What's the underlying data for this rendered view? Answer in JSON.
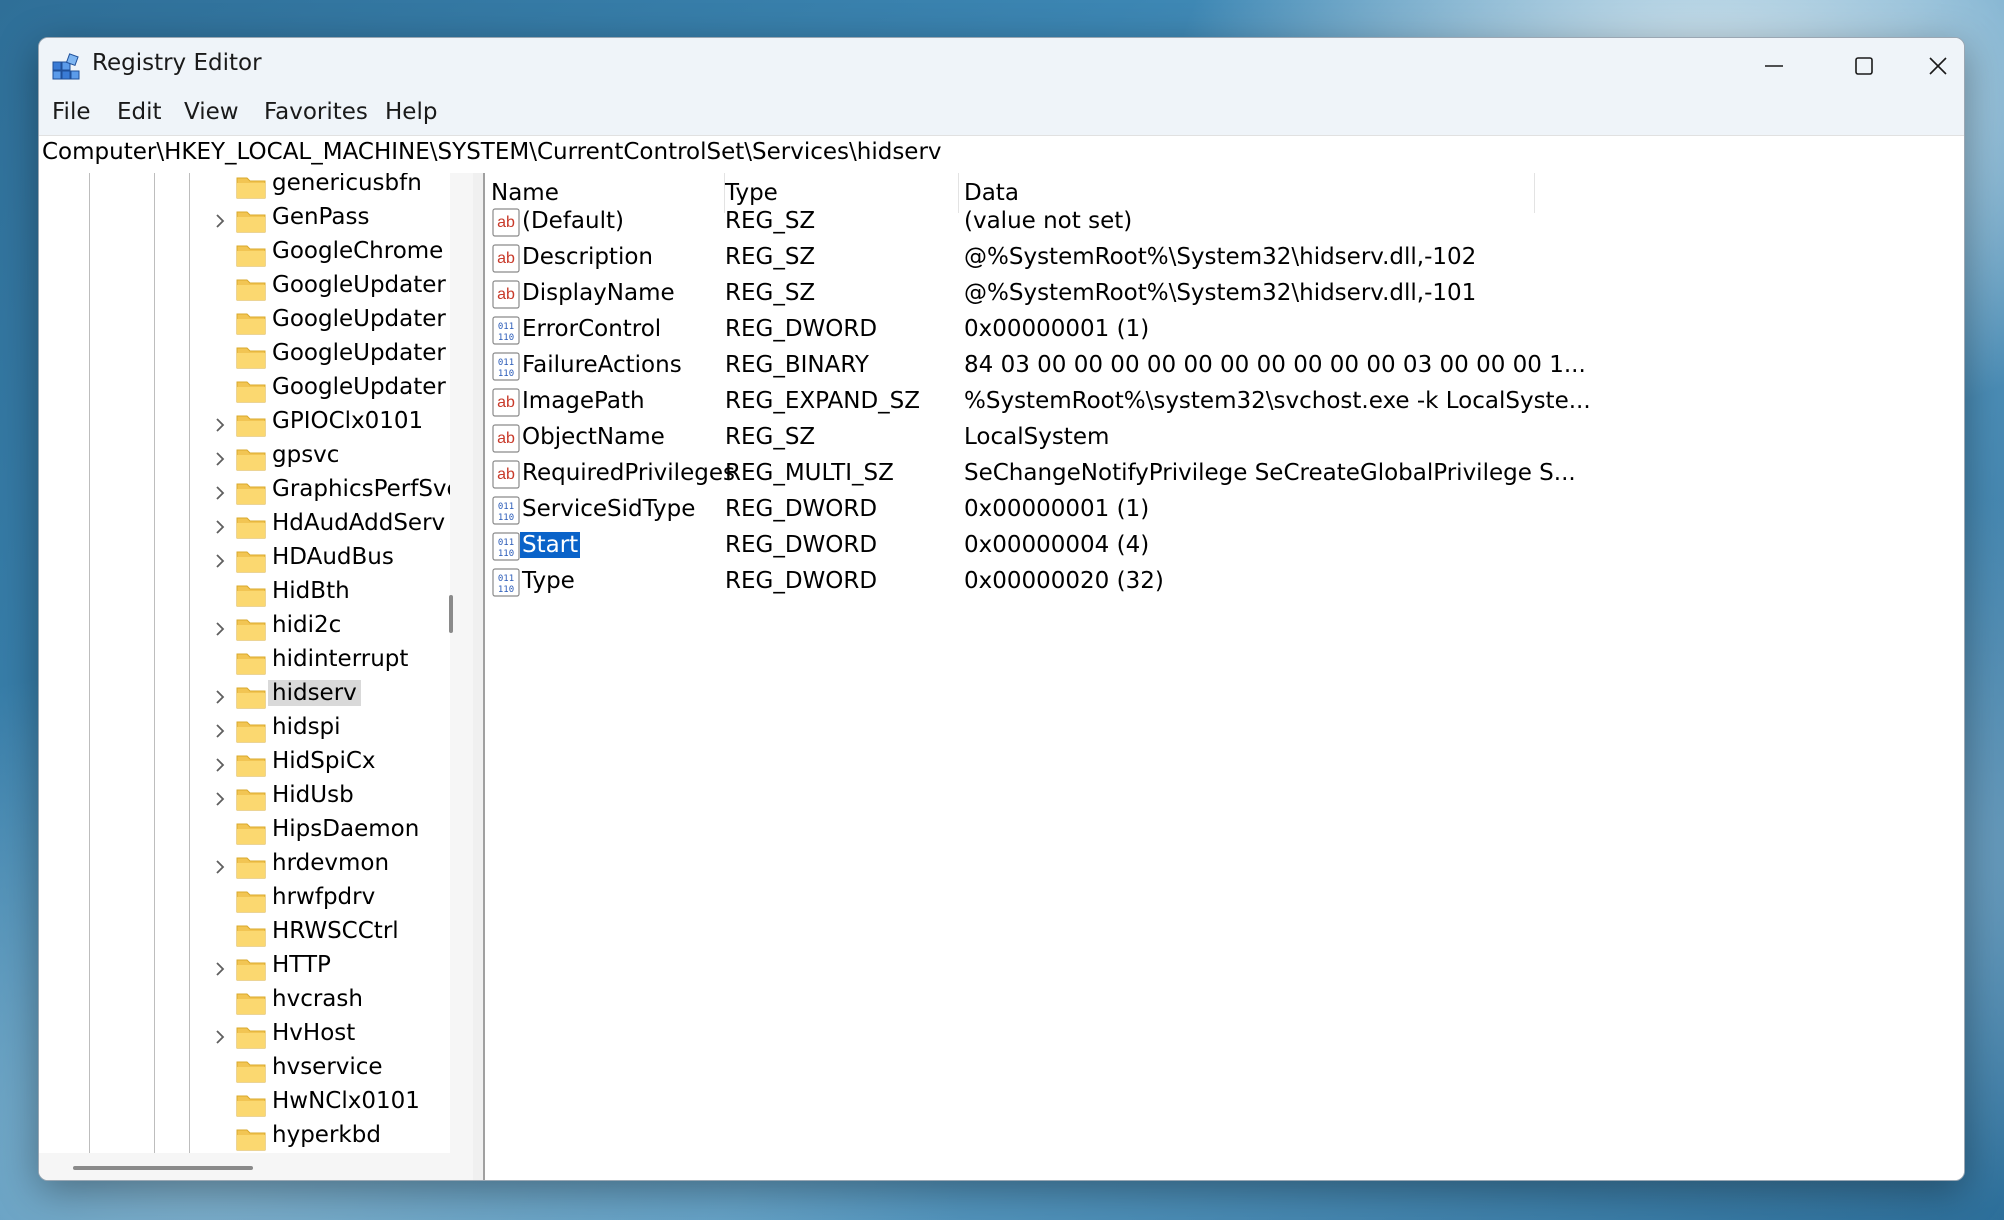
{
  "window": {
    "title": "Registry Editor"
  },
  "menu": [
    "File",
    "Edit",
    "View",
    "Favorites",
    "Help"
  ],
  "address": "Computer\\HKEY_LOCAL_MACHINE\\SYSTEM\\CurrentControlSet\\Services\\hidserv",
  "tree": [
    {
      "label": "genericusbfn",
      "expandable": false
    },
    {
      "label": "GenPass",
      "expandable": true
    },
    {
      "label": "GoogleChrome",
      "expandable": false
    },
    {
      "label": "GoogleUpdater",
      "expandable": false
    },
    {
      "label": "GoogleUpdater",
      "expandable": false
    },
    {
      "label": "GoogleUpdater",
      "expandable": false
    },
    {
      "label": "GoogleUpdater",
      "expandable": false
    },
    {
      "label": "GPIOClx0101",
      "expandable": true
    },
    {
      "label": "gpsvc",
      "expandable": true
    },
    {
      "label": "GraphicsPerfSvc",
      "expandable": true
    },
    {
      "label": "HdAudAddServ",
      "expandable": true
    },
    {
      "label": "HDAudBus",
      "expandable": true
    },
    {
      "label": "HidBth",
      "expandable": false
    },
    {
      "label": "hidi2c",
      "expandable": true
    },
    {
      "label": "hidinterrupt",
      "expandable": false
    },
    {
      "label": "hidserv",
      "expandable": true,
      "selected": true
    },
    {
      "label": "hidspi",
      "expandable": true
    },
    {
      "label": "HidSpiCx",
      "expandable": true
    },
    {
      "label": "HidUsb",
      "expandable": true
    },
    {
      "label": "HipsDaemon",
      "expandable": false
    },
    {
      "label": "hrdevmon",
      "expandable": true
    },
    {
      "label": "hrwfpdrv",
      "expandable": false
    },
    {
      "label": "HRWSCCtrl",
      "expandable": false
    },
    {
      "label": "HTTP",
      "expandable": true
    },
    {
      "label": "hvcrash",
      "expandable": false
    },
    {
      "label": "HvHost",
      "expandable": true
    },
    {
      "label": "hvservice",
      "expandable": false
    },
    {
      "label": "HwNClx0101",
      "expandable": false
    },
    {
      "label": "hyperkbd",
      "expandable": false
    }
  ],
  "columns": {
    "name": "Name",
    "type": "Type",
    "data": "Data"
  },
  "values": [
    {
      "name": "(Default)",
      "type": "REG_SZ",
      "data": "(value not set)",
      "icon": "string-value-icon"
    },
    {
      "name": "Description",
      "type": "REG_SZ",
      "data": "@%SystemRoot%\\System32\\hidserv.dll,-102",
      "icon": "string-value-icon"
    },
    {
      "name": "DisplayName",
      "type": "REG_SZ",
      "data": "@%SystemRoot%\\System32\\hidserv.dll,-101",
      "icon": "string-value-icon"
    },
    {
      "name": "ErrorControl",
      "type": "REG_DWORD",
      "data": "0x00000001 (1)",
      "icon": "binary-value-icon"
    },
    {
      "name": "FailureActions",
      "type": "REG_BINARY",
      "data": "84 03 00 00 00 00 00 00 00 00 00 00 03 00 00 00 1...",
      "icon": "binary-value-icon"
    },
    {
      "name": "ImagePath",
      "type": "REG_EXPAND_SZ",
      "data": "%SystemRoot%\\system32\\svchost.exe -k LocalSyste...",
      "icon": "string-value-icon"
    },
    {
      "name": "ObjectName",
      "type": "REG_SZ",
      "data": "LocalSystem",
      "icon": "string-value-icon"
    },
    {
      "name": "RequiredPrivileges",
      "type": "REG_MULTI_SZ",
      "data": "SeChangeNotifyPrivilege SeCreateGlobalPrivilege S...",
      "icon": "string-value-icon"
    },
    {
      "name": "ServiceSidType",
      "type": "REG_DWORD",
      "data": "0x00000001 (1)",
      "icon": "binary-value-icon"
    },
    {
      "name": "Start",
      "type": "REG_DWORD",
      "data": "0x00000004 (4)",
      "icon": "binary-value-icon",
      "selected": true
    },
    {
      "name": "Type",
      "type": "REG_DWORD",
      "data": "0x00000020 (32)",
      "icon": "binary-value-icon"
    }
  ]
}
